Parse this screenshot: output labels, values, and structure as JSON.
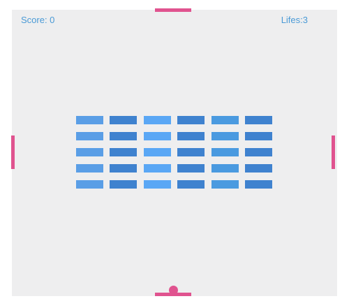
{
  "hud": {
    "score_text": "Score: 0",
    "lives_text": "Lifes:3"
  },
  "colors": {
    "board_background": "#eeeeef",
    "hud_text": "#4a9ad6",
    "paddle": "#e0538f",
    "ball": "#e0538f",
    "brick_columns": [
      "#5a9ee6",
      "#3f82cf",
      "#5aa7f5",
      "#3f82cf",
      "#4a9ae0",
      "#3f82cf"
    ]
  },
  "bricks": {
    "rows": 5,
    "columns": 6
  }
}
